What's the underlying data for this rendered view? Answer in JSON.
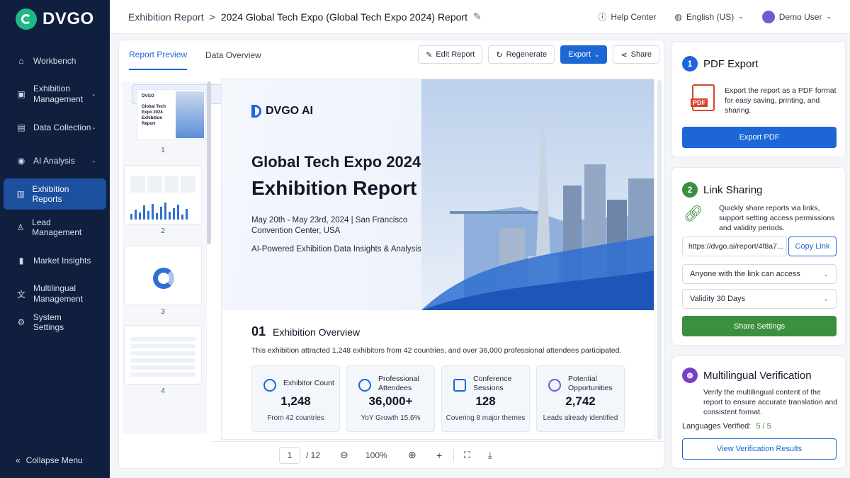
{
  "app": {
    "brand": "DVGO"
  },
  "sidebar": {
    "items": [
      {
        "label": "Workbench",
        "icon": "home-icon"
      },
      {
        "label": "Exhibition Management",
        "icon": "calendar-icon"
      },
      {
        "label": "Data Collection",
        "icon": "clipboard-icon"
      },
      {
        "label": "AI Analysis",
        "icon": "ai-icon"
      },
      {
        "label": "Exhibition Reports",
        "icon": "report-icon"
      },
      {
        "label": "Lead Management",
        "icon": "user-icon"
      },
      {
        "label": "Market Insights",
        "icon": "chart-icon"
      },
      {
        "label": "Multilingual Management",
        "icon": "translate-icon"
      },
      {
        "label": "System Settings",
        "icon": "gear-icon"
      }
    ],
    "collapse_label": "Collapse Menu"
  },
  "topbar": {
    "crumb_root": "Exhibition Report",
    "crumb_sep": ">",
    "crumb_current": "2024 Global Tech Expo (Global Tech Expo 2024) Report",
    "help": "Help Center",
    "language": "English (US)",
    "user": "Demo User"
  },
  "tabs": {
    "preview": "Report Preview",
    "overview": "Data Overview"
  },
  "toolbar": {
    "edit": "Edit Report",
    "regenerate": "Regenerate",
    "export": "Export",
    "share": "Share"
  },
  "thumbs": {
    "n1": "1",
    "n2": "2",
    "n3": "3",
    "n4": "4",
    "t1_brand": "DVGO",
    "t1_title": "Global Tech Expo 2024 Exhibition Report"
  },
  "doc": {
    "brand": "DVGO AI",
    "title1": "Global Tech Expo 2024",
    "title2": "Exhibition Report",
    "date": "May 20th - May 23rd, 2024 | San Francisco Convention Center, USA",
    "subtitle": "AI-Powered Exhibition Data Insights & Analysis",
    "section_num": "01",
    "section_title": "Exhibition Overview",
    "section_text": "This exhibition attracted 1,248 exhibitors from 42 countries, and over 36,000 professional attendees participated.",
    "cards": [
      {
        "label": "Exhibitor Count",
        "value": "1,248",
        "sub": "From 42 countries"
      },
      {
        "label": "Professional Attendees",
        "value": "36,000+",
        "sub": "YoY Growth 15.6%"
      },
      {
        "label": "Conference Sessions",
        "value": "128",
        "sub": "Covering 8 major themes"
      },
      {
        "label": "Potential Opportunities",
        "value": "2,742",
        "sub": "Leads already identified"
      }
    ]
  },
  "pager": {
    "page": "1",
    "total": "/ 12",
    "zoom": "100%"
  },
  "pdf_panel": {
    "num": "1",
    "title": "PDF Export",
    "icon_text": "PDF",
    "desc": "Export the report as a PDF format for easy saving, printing, and sharing.",
    "button": "Export PDF"
  },
  "link_panel": {
    "num": "2",
    "title": "Link Sharing",
    "desc": "Quickly share reports via links, support setting access permissions and validity periods.",
    "url": "https://dvgo.ai/report/4f8a7...",
    "copy": "Copy Link",
    "access": "Anyone with the link can access",
    "validity": "Validity 30 Days",
    "button": "Share Settings"
  },
  "verify_panel": {
    "title": "Multilingual Verification",
    "desc": "Verify the multilingual content of the report to ensure accurate translation and consistent format.",
    "label": "Languages Verified:",
    "value": "5 / 5",
    "button": "View Verification Results"
  },
  "colors": {
    "sidebar": "#0f1f3d",
    "accent": "#1d66d6",
    "success": "#3b8f3e",
    "brand": "#1fb98a"
  }
}
